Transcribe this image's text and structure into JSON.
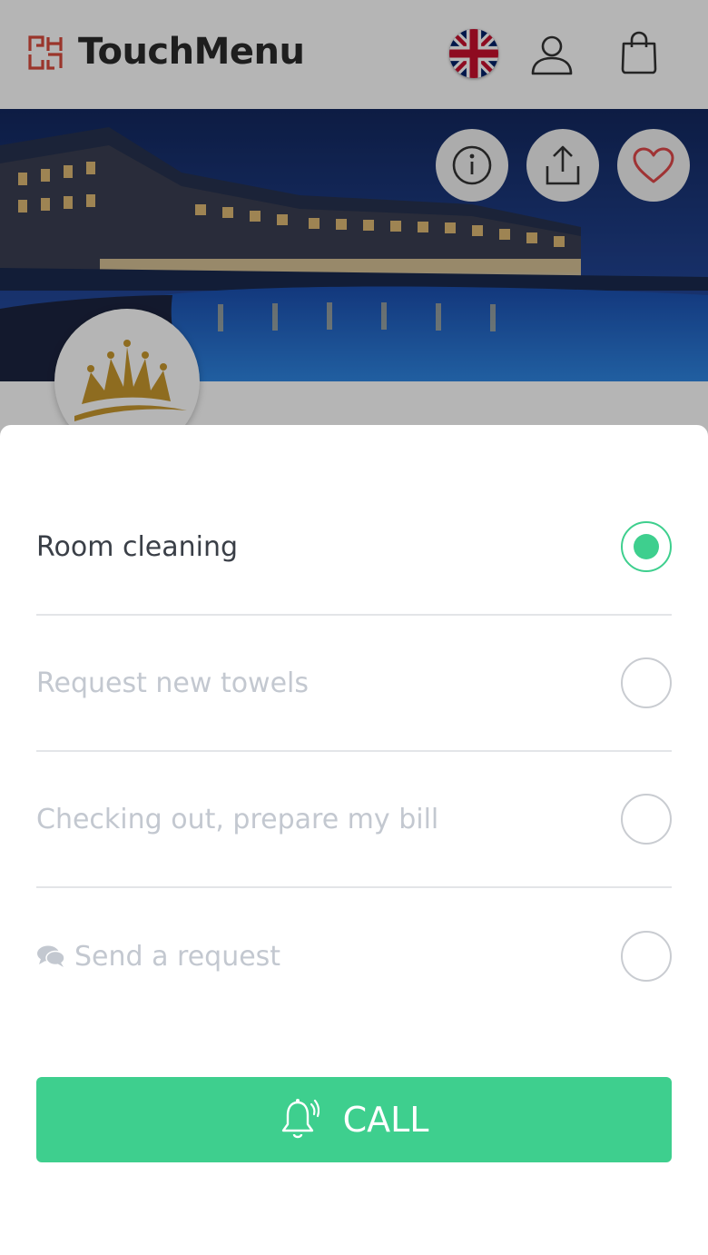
{
  "header": {
    "brand": "TouchMenu",
    "language": "English (UK)"
  },
  "hero": {
    "actions": [
      "info-icon",
      "share-icon",
      "heart-icon"
    ]
  },
  "options": [
    {
      "label": "Room cleaning",
      "selected": true
    },
    {
      "label": "Request new towels",
      "selected": false
    },
    {
      "label": "Checking out, prepare my bill",
      "selected": false
    },
    {
      "label": "Send a request",
      "selected": false,
      "icon": "chat-icon"
    }
  ],
  "call": {
    "label": "CALL",
    "icon": "bell-icon"
  },
  "colors": {
    "accent": "#3ecf8e",
    "brand_red": "#d94b3d",
    "muted_text": "#c3c8d0",
    "active_text": "#3a3f47",
    "favorite": "#e0484a"
  }
}
